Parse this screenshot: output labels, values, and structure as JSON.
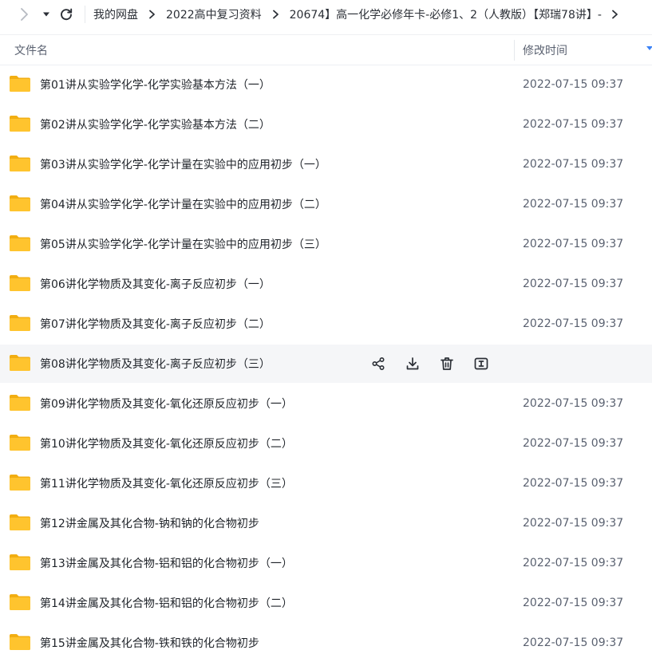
{
  "nav": {
    "back_icon": "chevron-left-icon",
    "dropdown_icon": "caret-down-icon",
    "refresh_icon": "refresh-icon",
    "breadcrumbs": [
      "我的网盘",
      "2022高中复习资料",
      "20674】高一化学必修年卡-必修1、2（人教版）【郑瑞78讲】-"
    ]
  },
  "header": {
    "name_label": "文件名",
    "time_label": "修改时间"
  },
  "hover_actions": [
    "share-icon",
    "download-icon",
    "delete-icon",
    "rename-icon"
  ],
  "colors": {
    "folder": "#FFC42E",
    "hover_row": "#f5f6f8",
    "sort_arrow": "#3b82f6"
  },
  "rows": [
    {
      "name": "第01讲从实验学化学-化学实验基本方法（一）",
      "time": "2022-07-15 09:37"
    },
    {
      "name": "第02讲从实验学化学-化学实验基本方法（二）",
      "time": "2022-07-15 09:37"
    },
    {
      "name": "第03讲从实验学化学-化学计量在实验中的应用初步（一）",
      "time": "2022-07-15 09:37"
    },
    {
      "name": "第04讲从实验学化学-化学计量在实验中的应用初步（二）",
      "time": "2022-07-15 09:37"
    },
    {
      "name": "第05讲从实验学化学-化学计量在实验中的应用初步（三）",
      "time": "2022-07-15 09:37"
    },
    {
      "name": "第06讲化学物质及其变化-离子反应初步（一）",
      "time": "2022-07-15 09:37"
    },
    {
      "name": "第07讲化学物质及其变化-离子反应初步（二）",
      "time": "2022-07-15 09:37"
    },
    {
      "name": "第08讲化学物质及其变化-离子反应初步（三）",
      "time": ""
    },
    {
      "name": "第09讲化学物质及其变化-氧化还原反应初步（一）",
      "time": "2022-07-15 09:37"
    },
    {
      "name": "第10讲化学物质及其变化-氧化还原反应初步（二）",
      "time": "2022-07-15 09:37"
    },
    {
      "name": "第11讲化学物质及其变化-氧化还原反应初步（三）",
      "time": "2022-07-15 09:37"
    },
    {
      "name": "第12讲金属及其化合物-钠和钠的化合物初步",
      "time": "2022-07-15 09:37"
    },
    {
      "name": "第13讲金属及其化合物-铝和铝的化合物初步（一）",
      "time": "2022-07-15 09:37"
    },
    {
      "name": "第14讲金属及其化合物-铝和铝的化合物初步（二）",
      "time": "2022-07-15 09:37"
    },
    {
      "name": "第15讲金属及其化合物-铁和铁的化合物初步",
      "time": "2022-07-15 09:37"
    }
  ]
}
